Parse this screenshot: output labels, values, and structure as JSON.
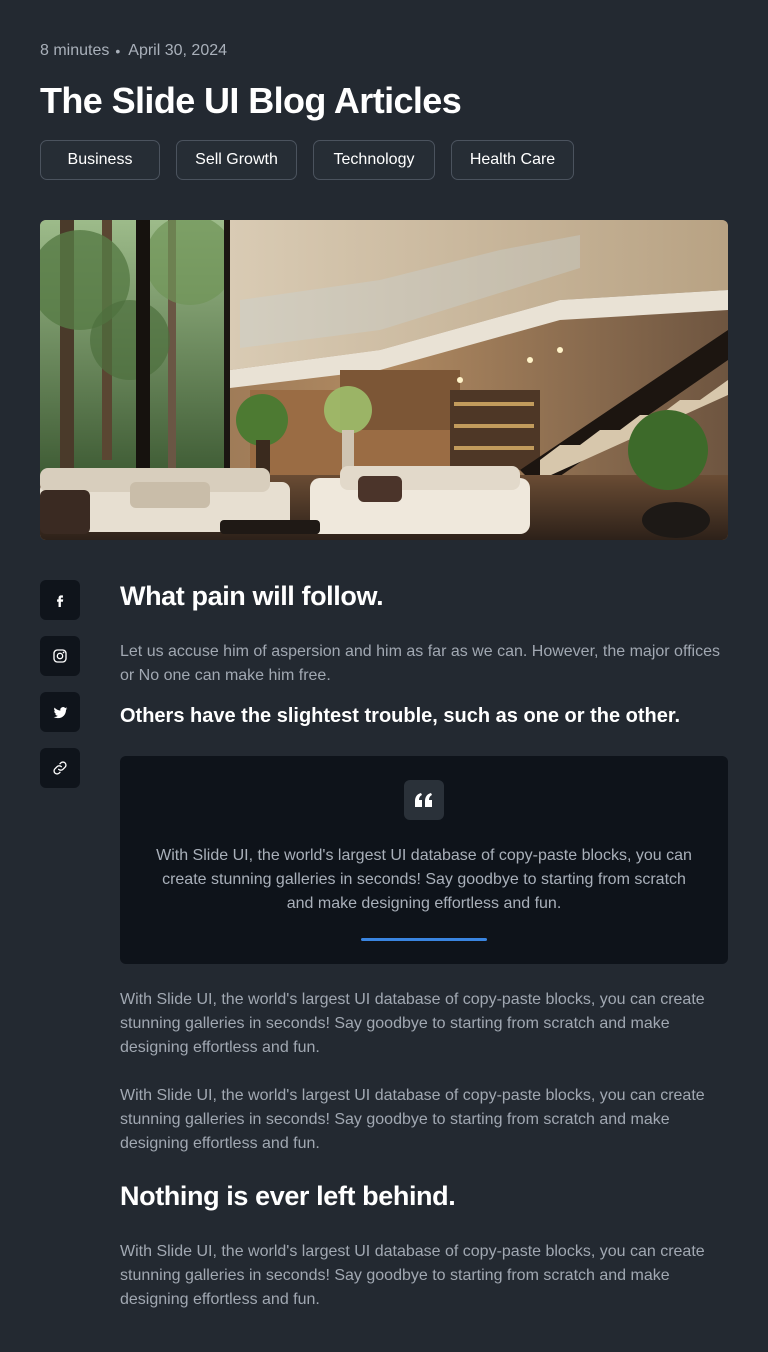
{
  "meta": {
    "read_time": "8 minutes",
    "date": "April 30, 2024"
  },
  "title": "The Slide UI Blog Articles",
  "tags": [
    "Business",
    "Sell Growth",
    "Technology",
    "Health Care"
  ],
  "social": [
    {
      "icon": "facebook-icon"
    },
    {
      "icon": "instagram-icon"
    },
    {
      "icon": "twitter-icon"
    },
    {
      "icon": "link-icon"
    }
  ],
  "article": {
    "heading_1": "What pain will follow.",
    "para_1": "Let us accuse him of aspersion and him as far as we can. However, the major offices or No one can make him free.",
    "subheading": "Others have the slightest trouble, such as one or the other.",
    "quote": {
      "icon": "quote-icon",
      "text": "With Slide UI, the world's largest UI database of copy-paste blocks, you can create stunning galleries in seconds! Say goodbye to starting from scratch and make designing effortless and fun.",
      "accent_color": "#3a85e0"
    },
    "para_2": "With Slide UI, the world's largest UI database of copy-paste blocks, you can create stunning galleries in seconds! Say goodbye to starting from scratch and make designing effortless and fun.",
    "para_3": "With Slide UI, the world's largest UI database of copy-paste blocks, you can create stunning galleries in seconds! Say goodbye to starting from scratch and make designing effortless and fun.",
    "heading_2": "Nothing is ever left behind.",
    "para_4": "With Slide UI, the world's largest UI database of copy-paste blocks, you can create stunning galleries in seconds! Say goodbye to starting from scratch and make designing effortless and fun."
  },
  "colors": {
    "background": "#232931",
    "card": "#0e131a",
    "accent": "#3a85e0"
  }
}
